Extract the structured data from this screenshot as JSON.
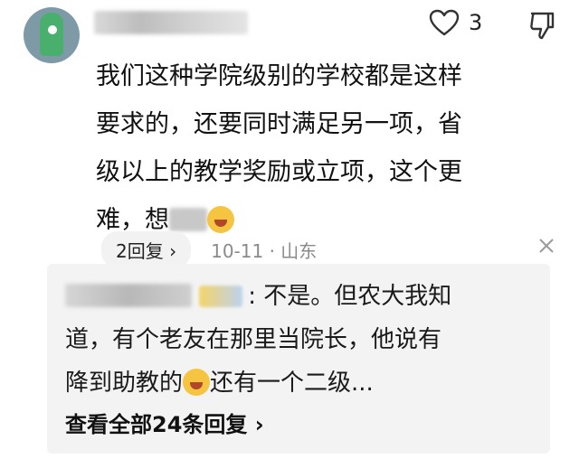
{
  "comment": {
    "like_count": "3",
    "text_line1": "我们这种学院级别的学校都是这样",
    "text_line2": "要求的，还要同时满足另一项，省",
    "text_line3": "级以上的教学奖励或立项，这个更",
    "text_line4_a": "难，想",
    "reply_pill": "2回复 ›",
    "date_location": "10-11 · 山东"
  },
  "reply": {
    "prefix": ": 不是。但农大我知",
    "line2": "道，有个老友在那里当院长，他说有",
    "line3_a": "降到助教的",
    "line3_b": "还有一个二级...",
    "view_all": "查看全部24条回复 ›"
  },
  "icons": {
    "like": "heart-outline-icon",
    "dislike": "thumbs-down-icon",
    "close": "close-icon",
    "emoji": "crying-laughing-emoji"
  }
}
